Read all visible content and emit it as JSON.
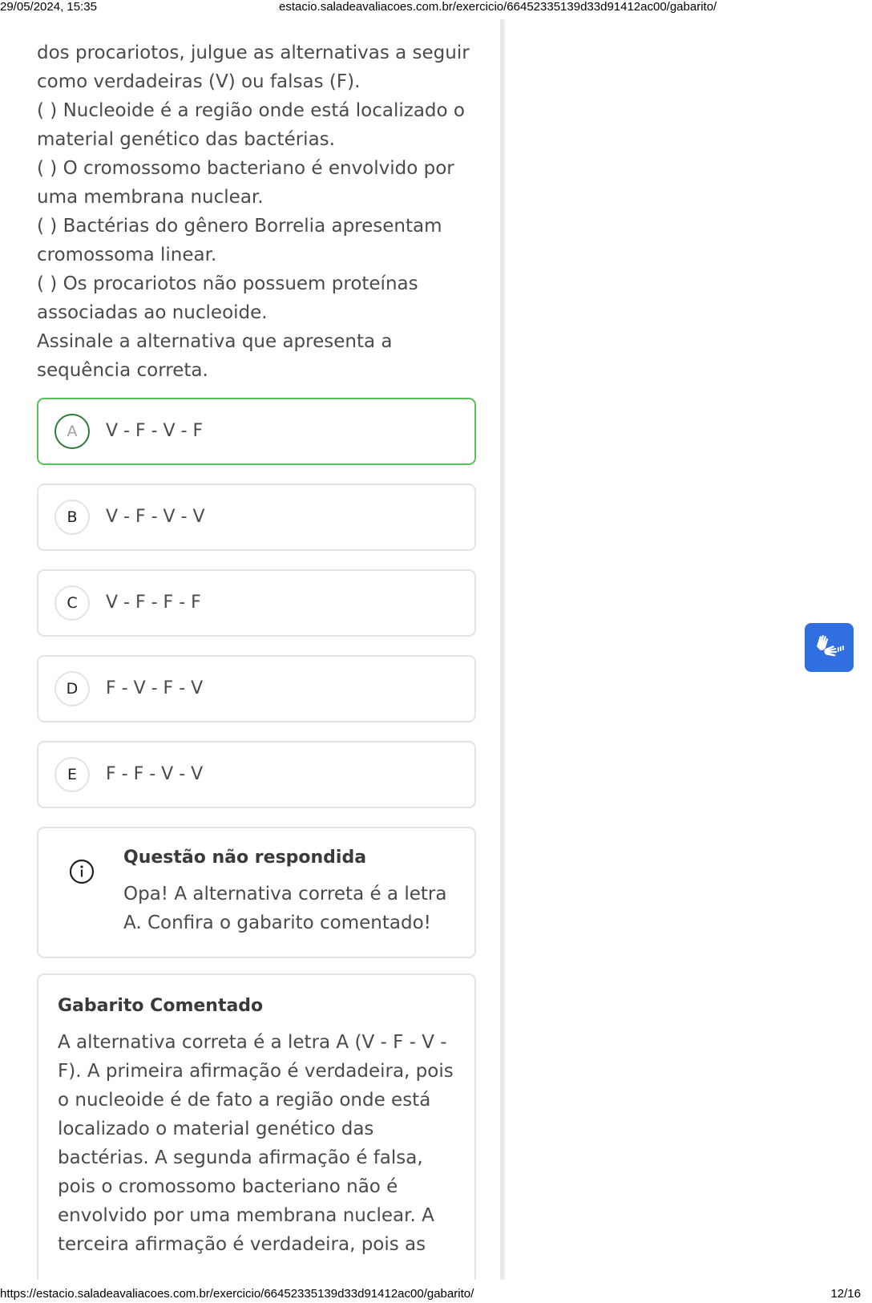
{
  "print_header": {
    "datetime": "29/05/2024, 15:35",
    "url": "estacio.saladeavaliacoes.com.br/exercicio/66452335139d33d91412ac00/gabarito/"
  },
  "print_footer": {
    "url": "https://estacio.saladeavaliacoes.com.br/exercicio/66452335139d33d91412ac00/gabarito/",
    "page": "12/16"
  },
  "question": {
    "lines": [
      "dos procariotos, julgue as alternativas a seguir",
      "como verdadeiras (V) ou falsas (F).",
      "( ) Nucleoide é a região onde está localizado o",
      "material genético das bactérias.",
      "( ) O cromossomo bacteriano é envolvido por",
      "uma membrana nuclear.",
      "( ) Bactérias do gênero Borrelia apresentam",
      "cromossoma linear.",
      "( ) Os procariotos não possuem proteínas",
      "associadas ao nucleoide.",
      "Assinale a alternativa que apresenta a",
      "sequência correta."
    ]
  },
  "options": [
    {
      "letter": "A",
      "text": "V - F - V - F",
      "correct": true
    },
    {
      "letter": "B",
      "text": "V - F - V - V",
      "correct": false
    },
    {
      "letter": "C",
      "text": "V - F - F - F",
      "correct": false
    },
    {
      "letter": "D",
      "text": "F - V - F - V",
      "correct": false
    },
    {
      "letter": "E",
      "text": "F - F - V - V",
      "correct": false
    }
  ],
  "feedback": {
    "icon": "info-icon",
    "title": "Questão não respondida",
    "lines": [
      "Opa! A alternativa correta é a letra",
      "A. Confira o gabarito comentado!"
    ]
  },
  "gabarito": {
    "title": "Gabarito Comentado",
    "lines": [
      "A alternativa correta é a letra A (V - F - V -",
      "F). A primeira afirmação é verdadeira, pois",
      "o nucleoide é de fato a região onde está",
      "localizado o material genético das",
      "bactérias. A segunda afirmação é falsa,",
      "pois o cromossomo bacteriano não é",
      "envolvido por uma membrana nuclear. A",
      "terceira afirmação é verdadeira, pois as"
    ]
  },
  "accessibility_widget": {
    "icon": "sign-language-hands-icon",
    "color": "#2f6fe0"
  },
  "colors": {
    "correct_border": "#5ac15a",
    "correct_letter_ring": "#2f7a38",
    "card_border": "#e3e3e3",
    "text": "#4a4a4a"
  }
}
